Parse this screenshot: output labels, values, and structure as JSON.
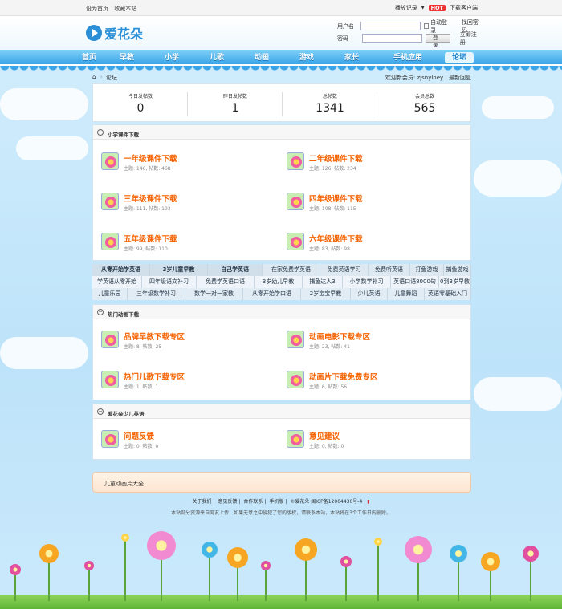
{
  "topbar": {
    "set_home": "设为首页",
    "bookmark": "收藏本站",
    "play_history": "播放记录",
    "hot_badge": "HOT",
    "download_client": "下载客户端"
  },
  "header": {
    "logo_text": "爱花朵",
    "username_label": "用户名",
    "password_label": "密码",
    "auto_login": "自动登录",
    "forgot_password": "找回密码",
    "login_button": "登录",
    "register": "立即注册"
  },
  "nav": {
    "items": [
      "首页",
      "早教",
      "小学",
      "儿歌",
      "动画",
      "游戏",
      "家长",
      "手机应用",
      "论坛"
    ],
    "active": "论坛"
  },
  "breadcrumb": {
    "current": "论坛",
    "welcome": "欢迎新会员: zjsnylney",
    "latest_replies": "最新回复"
  },
  "stats": [
    {
      "label": "今日发帖数",
      "value": "0"
    },
    {
      "label": "昨日发帖数",
      "value": "1"
    },
    {
      "label": "总帖数",
      "value": "1341"
    },
    {
      "label": "会员总数",
      "value": "565"
    }
  ],
  "sections": [
    {
      "title": "小学课件下载",
      "forums": [
        {
          "name": "一年级课件下载",
          "meta": "主题: 146, 帖数: 468"
        },
        {
          "name": "二年级课件下载",
          "meta": "主题: 126, 帖数: 234"
        },
        {
          "name": "三年级课件下载",
          "meta": "主题: 111, 帖数: 193"
        },
        {
          "name": "四年级课件下载",
          "meta": "主题: 108, 帖数: 115"
        },
        {
          "name": "五年级课件下载",
          "meta": "主题: 99, 帖数: 110"
        },
        {
          "name": "六年级课件下载",
          "meta": "主题: 83, 帖数: 98"
        }
      ]
    },
    {
      "title": "热门动画下载",
      "forums": [
        {
          "name": "品牌早教下载专区",
          "meta": "主题: 8, 帖数: 25"
        },
        {
          "name": "动画电影下载专区",
          "meta": "主题: 23, 帖数: 41"
        },
        {
          "name": "热门儿歌下载专区",
          "meta": "主题: 1, 帖数: 1"
        },
        {
          "name": "动画片下载免费专区",
          "meta": "主题: 6, 帖数: 56"
        }
      ]
    },
    {
      "title": "爱花朵少儿英语",
      "forums": [
        {
          "name": "问题反馈",
          "meta": "主题: 0, 帖数: 0"
        },
        {
          "name": "意见建议",
          "meta": "主题: 0, 帖数: 0"
        }
      ]
    }
  ],
  "tag_rows": [
    [
      "从零开始学英语",
      "3岁儿童早教",
      "自己学英语",
      "在家免费学英语",
      "免费英语学习",
      "免费听英语",
      "打鱼游戏",
      "捕鱼游戏"
    ],
    [
      "学英语从零开始",
      "四年级语文补习",
      "免费学英语口语",
      "3岁幼儿早教",
      "捕鱼达人3",
      "小学数学补习",
      "英语口语8000句",
      "0到3岁早教"
    ],
    [
      "儿童乐园",
      "三年级数学补习",
      "数学一对一家教",
      "从零开始学口语",
      "2岁宝宝早教",
      "少儿英语",
      "儿童舞蹈",
      "英语零基础入门"
    ]
  ],
  "banner": {
    "text": "儿童动画片大全"
  },
  "footer": {
    "links": [
      "关于我们",
      "意见反馈",
      "合作联系",
      "手机版",
      "©爱花朵 闽ICP备12004430号-4"
    ],
    "note": "本站部分资源来自网友上传，如果无意之中侵犯了您的版权，请联系本站，本站将在3个工作日内删除。"
  },
  "colors": {
    "forum_name": "#f56200",
    "nav_top": "#7fd0f8",
    "nav_bottom": "#3aa4e8",
    "hot_badge": "#e33333"
  }
}
